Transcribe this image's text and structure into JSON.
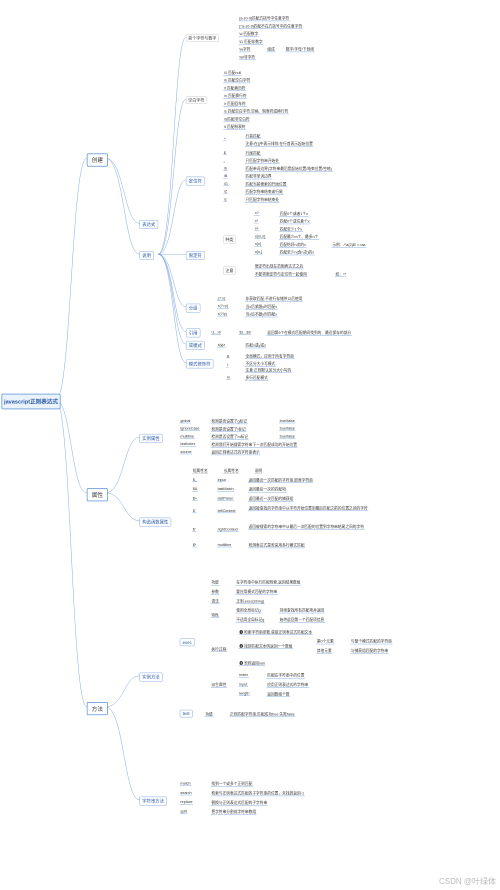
{
  "root": "javascript正则表达式",
  "cats": {
    "create": "创建",
    "attrs": "属性",
    "methods": "方法"
  },
  "subs": {
    "expr": "表达式",
    "explain": "说明",
    "anchor": "定位符",
    "quant": "限定符",
    "group": "分组",
    "ref": "引用",
    "or": "或模式",
    "modeFlag": "模式修饰符",
    "instProps": "实例属性",
    "ctorProps": "构造函数属性",
    "instMeth": "实例方法",
    "strMeth": "字符串方法",
    "exec": "exec",
    "test": "test",
    "match": "match",
    "search": "search",
    "replace": "replace",
    "split": "split",
    "single": "首个字符与数字",
    "space": "空白字符",
    "kinds": "种类",
    "notes": "注意",
    "global": "global",
    "ic": "ignoreCase",
    "ml": "multiline",
    "li": "lastIndex",
    "src": "source",
    "sin": "$_",
    "slm": "$&",
    "slp": "$+",
    "slc": "$`",
    "src2": "$'",
    "smul": "$*",
    "func": "功能",
    "args": "参数",
    "grammar": "语法",
    "special": "特性",
    "run": "执行过程",
    "ret": "派生属性"
  },
  "leaves": {
    "c1": "[a-z0-9]匹配方括号中任意字符",
    "c2": "[^a-z0-9]匹配不在方括号中的任意字符",
    "c3": "\\d 匹配数字",
    "c4": "\\D 匹配非数字",
    "c5": "\\w字符",
    "c5a": "组成",
    "c5b": "数字/字母/下划线",
    "c6": "\\W非字符",
    "s1": "\\0 匹配null",
    "s2": "\\b 匹配空白字符",
    "s3": "\\f 匹配换页符",
    "s4": "\\n 匹配换行符",
    "s5": "\\r 匹配回车符",
    "s6": "\\s 匹配空白字符,空格、制表符或换行符",
    "s7": "\\S匹配非空白符",
    "s8": "\\t 匹配制表符",
    "a0a": "^",
    "a0b": "行首匹配",
    "a0c": "注意:在[]中表示排除,在行首表示起始位置",
    "a1a": "$",
    "a1b": "行尾匹配",
    "a2a": ".",
    "a2b": "只匹配字符串开始处",
    "a3a": "\\b",
    "a3b": "匹配单词边界(字符串最后是起始位置/结束位置/空格)",
    "a4a": "\\B",
    "a4b": "匹配非单词边界",
    "a5a": "\\G",
    "a5b": "匹配当前搜索的开始位置",
    "a6a": "\\Z",
    "a6b": "匹配字符串结束或行尾",
    "a7a": "\\z",
    "a7b": "只匹配字符串结束处",
    "q1a": "x?",
    "q1b": "匹配0个或者1个x",
    "q2a": "x*",
    "q2b": "匹配0个或任意个x",
    "q3a": "x+",
    "q3b": "匹配至少1个x",
    "q4a": "x{m,n}",
    "q4b": "匹配最少m个、最多n个",
    "q5a": "x{n}",
    "q5b": "匹配恰好n次的x",
    "q5c": "示例：/^a{2}$/  =>aa",
    "q6a": "x{n,}",
    "q6b": "匹配至少n(含n次)的x",
    "qn1": "限定符出现在范围表达式之后",
    "qn2": "不能将限定符与定位符一起使用",
    "qn3": "如：^*",
    "g1a": "(?:x)",
    "g1b": "非获取匹配,不进行存储供以后使用",
    "g2a": "x(?=y)",
    "g2b": "当x后紧跟y时匹配x",
    "g3a": "x(?!y)",
    "g3b": "当x后不跟y时匹配x",
    "r1": "\\1...\\9",
    "r2": "$1...$9",
    "r3": "返回第9个在模式匹配期间找到的、最近保存的部分",
    "o1": "x|y|z",
    "o2": "匹配x或y或z",
    "m1a": "g",
    "m1b": "全局模式，应用于所有字符串",
    "m2a": "i",
    "m2b": "不区分大小写模式",
    "m2c": "注意:正则默认区分大小写的",
    "m3a": "m",
    "m3b": "多行匹配模式",
    "p1": "检测是否设置了g标记",
    "p1v": "true/false",
    "p2": "检测是否设置了i标记",
    "p2v": "true/false",
    "p3": "检测是否设置了m标记",
    "p3v": "true/false",
    "p4": "检测我们开始搜索字符串下一次匹配成功的开始位置",
    "p5": "返回正则表达式的字符串表示",
    "cp0a": "短属性名",
    "cp0b": "长属性名",
    "cp0c": "说明",
    "cp1": "input",
    "cp1d": "返回最近一次匹配的字符串,即原字符串",
    "cp2": "lastMatch",
    "cp2d": "返回最后一次的匹配项",
    "cp3": "lastParen",
    "cp3d": "返回最近一次匹配的捕获组",
    "cp4": "leftContext",
    "cp4d": "返回被查找的字符串中从字符开始位置到最后匹配之前的位置之间的字符",
    "cp5": "rightContext",
    "cp5d": "返回被搜索的字符串中从最后一次匹配的位置到字符串结尾之间的字符",
    "cp6": "multiline",
    "cp6d": "检测表达式是否采用多行模式匹配",
    "e1": "在字符串中执行匹配检索,返回结果数组",
    "e2": "要应用模式匹配的字符串",
    "e3": "正则.exec(string)",
    "e4a": "使用全局标记g",
    "e4b": "持续查找所有匹配项并返回",
    "e5a": "不适用全局标记g",
    "e5b": "始终返回第一个匹配项信息",
    "er1": "❶ 检索字符串参数,获取正则表达式匹配文本",
    "er2": "❷ 找到匹配文本则返回一个数组",
    "er2a": "第0个元素",
    "er2b": "与整个模式匹配的字符串",
    "er2c": "其他元素",
    "er2d": "与捕获组匹配的字符串",
    "er3": "❸ 否则返回null",
    "ed1": "index",
    "ed1d": "匹配在字符串中的位置",
    "ed2": "input",
    "ed2d": "应用正则表达式的字符串",
    "ed3": "length",
    "ed3d": "返回数组个数",
    "t1": "正则匹配字符串,匹配成功true 失败false",
    "mm1": "找到一个或多个正则匹配",
    "ms2": "检索与正则表达式匹配的子字符串的位置，未找到返回-1",
    "mr3": "替换与正则表达式匹配的子字符串",
    "ms4": "把字符串分割成字符串数组"
  },
  "watermark": "CSDN @叶绿体"
}
